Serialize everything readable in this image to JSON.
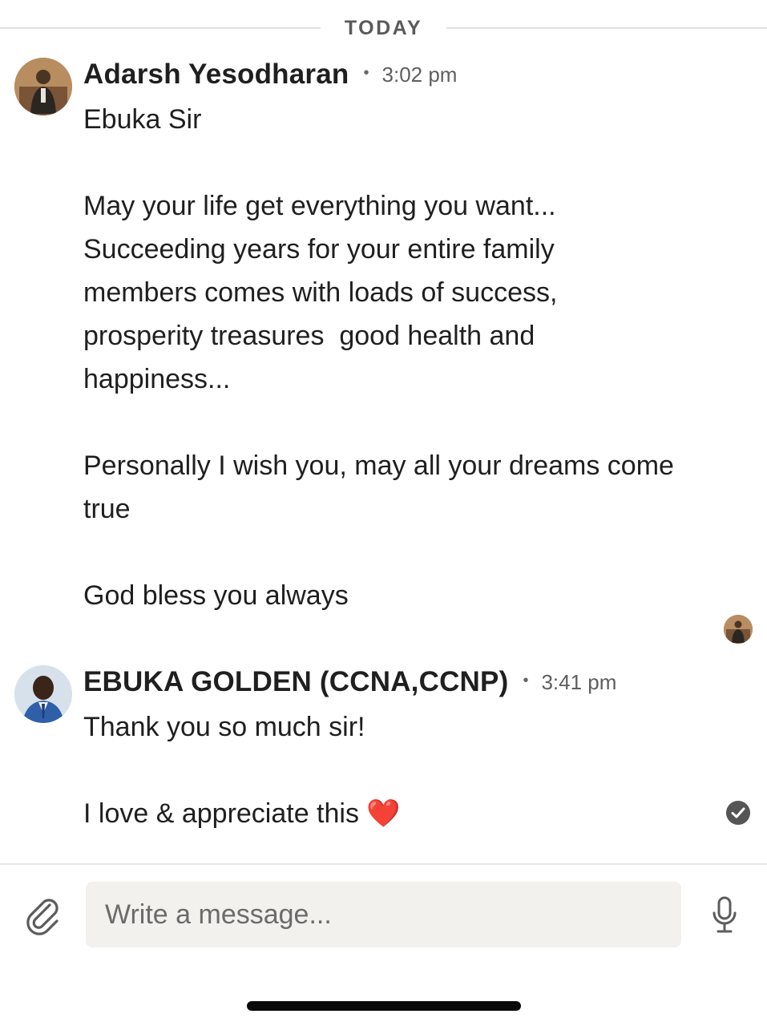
{
  "date_divider": {
    "label": "TODAY"
  },
  "messages": [
    {
      "sender": "Adarsh Yesodharan",
      "time": "3:02 pm",
      "lines": [
        "Ebuka Sir",
        "",
        "May your life get everything you want...",
        "Succeeding years for your entire family",
        "members comes with loads of success,",
        "prosperity treasures  good health and",
        "happiness...",
        "",
        "Personally I wish you, may all your dreams come",
        "true",
        "",
        "God bless you always"
      ]
    },
    {
      "sender": "EBUKA GOLDEN (CCNA,CCNP)",
      "time": "3:41 pm",
      "lines": [
        "Thank you so much sir!",
        "",
        "I love & appreciate this ❤️"
      ]
    }
  ],
  "composer": {
    "placeholder": "Write a message..."
  },
  "icons": {
    "attach": "paperclip-icon",
    "mic": "microphone-icon",
    "read_receipt": "check-circle-icon"
  },
  "colors": {
    "text": "#1f1f1f",
    "muted": "#5e5e5e",
    "input_bg": "#f2f1ee"
  }
}
